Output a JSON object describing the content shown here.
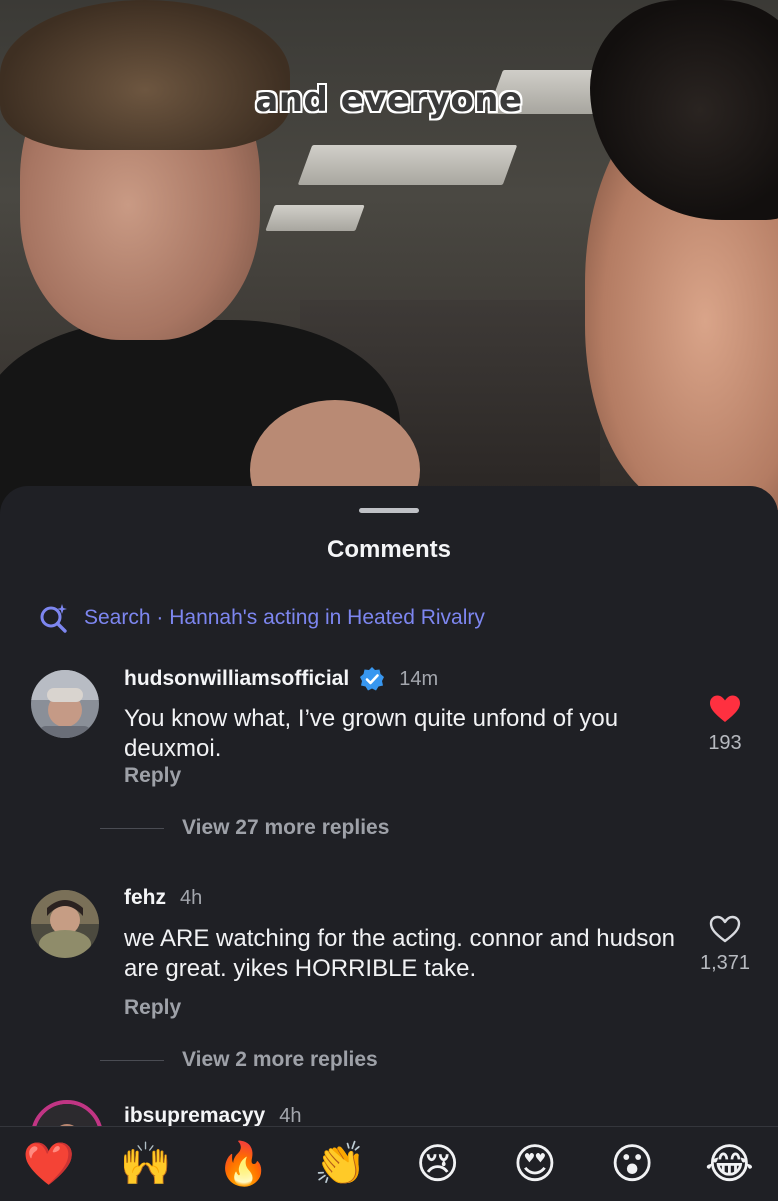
{
  "video": {
    "caption": "and everyone"
  },
  "sheet": {
    "title": "Comments",
    "search": {
      "prefix": "Search",
      "separator": " · ",
      "query": "Hannah's acting in Heated Rivalry"
    }
  },
  "comments": [
    {
      "username": "hudsonwilliamsofficial",
      "verified": true,
      "time": "14m",
      "text": "You know what, I’ve grown quite unfond of you deuxmoi.",
      "reply_label": "Reply",
      "likes": "193",
      "liked": true,
      "view_more": "View 27 more replies"
    },
    {
      "username": "fehz",
      "verified": false,
      "time": "4h",
      "text": "we ARE watching for the acting. connor and hudson are great. yikes HORRIBLE take.",
      "reply_label": "Reply",
      "likes": "1,371",
      "liked": false,
      "view_more": "View 2 more replies"
    },
    {
      "username": "ibsupremacyy",
      "time": "4h"
    }
  ],
  "reactions": [
    "❤️",
    "🙌",
    "🔥",
    "👏",
    "😢",
    "😍",
    "😮",
    "😂"
  ],
  "colors": {
    "accent_link": "#7d86f0",
    "like_red": "#ff3040",
    "sheet_bg": "#1f2025",
    "verified_blue": "#3897f0"
  }
}
